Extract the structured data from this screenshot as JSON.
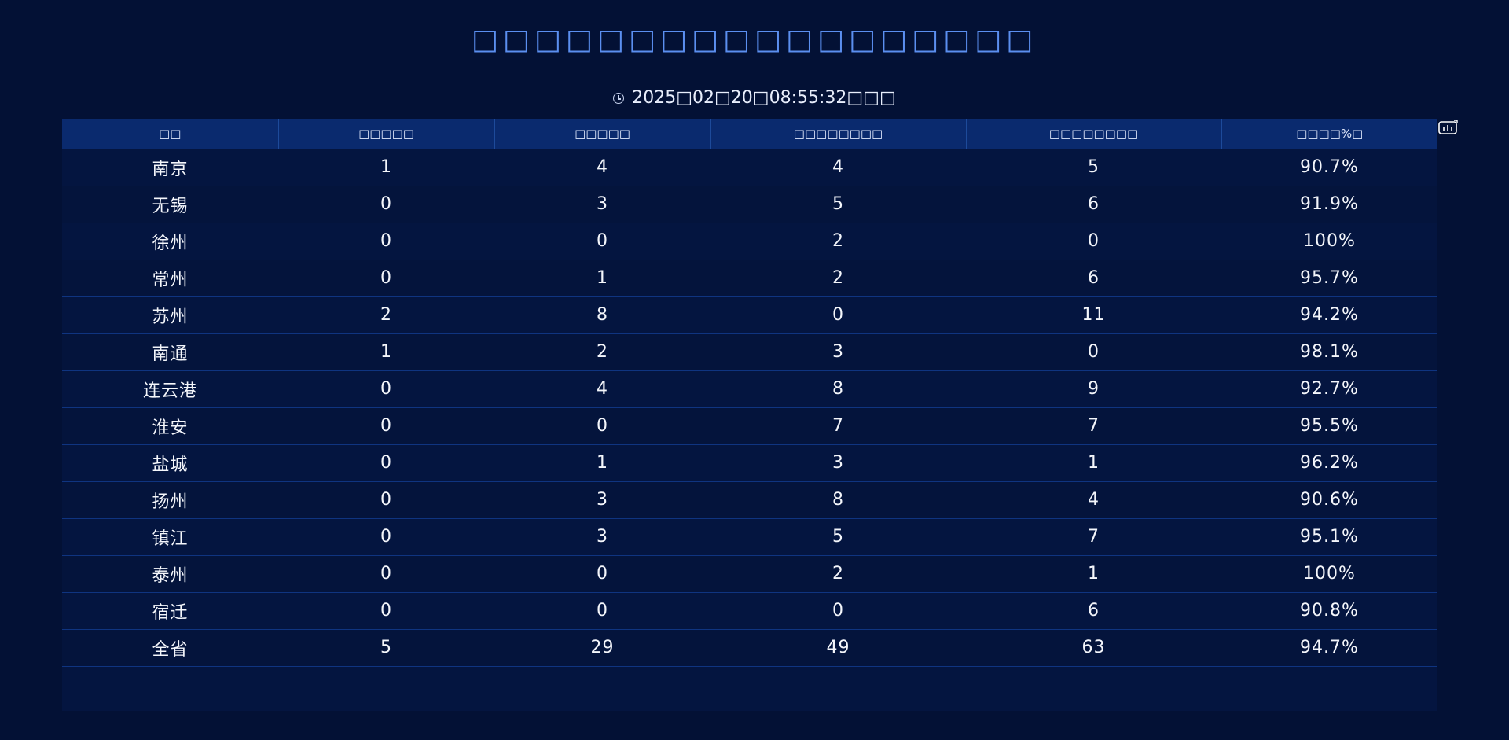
{
  "title": "□□□□□□□□□□□□□□□□□□",
  "timestamp": "2025□02□20□08:55:32□□□",
  "icons": {
    "clock": "clock-icon",
    "chart": "bar-chart-icon"
  },
  "colors": {
    "background": "#031135",
    "title": "#5b8ff0",
    "header_bg": "#0a2a6e",
    "row_border": "#0f3480"
  },
  "table": {
    "headers": [
      "□□",
      "□□□□□",
      "□□□□□",
      "□□□□□□□□",
      "□□□□□□□□",
      "□□□□%□"
    ],
    "rows": [
      [
        "南京",
        "1",
        "4",
        "4",
        "5",
        "90.7%"
      ],
      [
        "无锡",
        "0",
        "3",
        "5",
        "6",
        "91.9%"
      ],
      [
        "徐州",
        "0",
        "0",
        "2",
        "0",
        "100%"
      ],
      [
        "常州",
        "0",
        "1",
        "2",
        "6",
        "95.7%"
      ],
      [
        "苏州",
        "2",
        "8",
        "0",
        "11",
        "94.2%"
      ],
      [
        "南通",
        "1",
        "2",
        "3",
        "0",
        "98.1%"
      ],
      [
        "连云港",
        "0",
        "4",
        "8",
        "9",
        "92.7%"
      ],
      [
        "淮安",
        "0",
        "0",
        "7",
        "7",
        "95.5%"
      ],
      [
        "盐城",
        "0",
        "1",
        "3",
        "1",
        "96.2%"
      ],
      [
        "扬州",
        "0",
        "3",
        "8",
        "4",
        "90.6%"
      ],
      [
        "镇江",
        "0",
        "3",
        "5",
        "7",
        "95.1%"
      ],
      [
        "泰州",
        "0",
        "0",
        "2",
        "1",
        "100%"
      ],
      [
        "宿迁",
        "0",
        "0",
        "0",
        "6",
        "90.8%"
      ],
      [
        "全省",
        "5",
        "29",
        "49",
        "63",
        "94.7%"
      ]
    ]
  }
}
